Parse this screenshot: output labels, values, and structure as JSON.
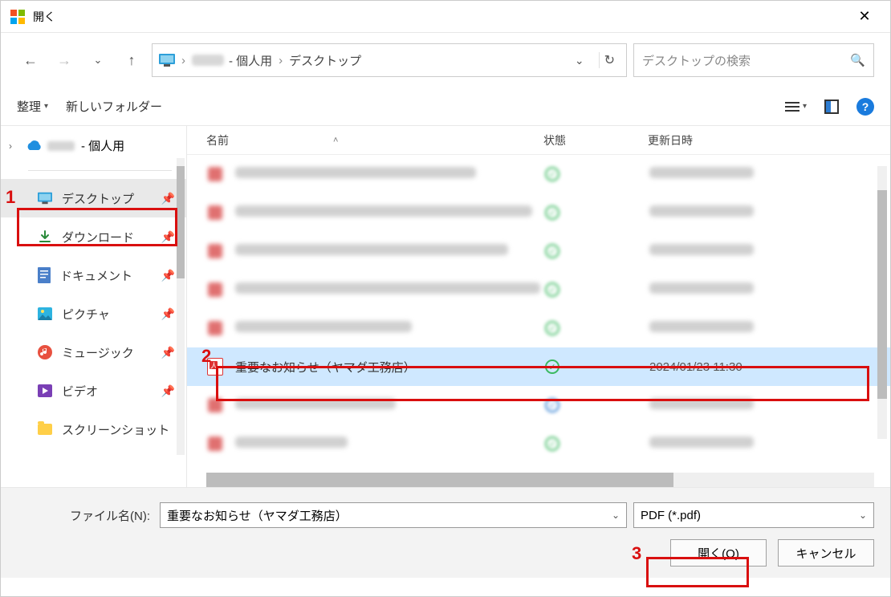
{
  "title": "開く",
  "breadcrumb": {
    "personal": "- 個人用",
    "desktop": "デスクトップ"
  },
  "search": {
    "placeholder": "デスクトップの検索"
  },
  "toolbar": {
    "organize": "整理",
    "newfolder": "新しいフォルダー"
  },
  "tree": {
    "root_personal": "- 個人用"
  },
  "sidebar": {
    "items": [
      {
        "label": "デスクトップ"
      },
      {
        "label": "ダウンロード"
      },
      {
        "label": "ドキュメント"
      },
      {
        "label": "ピクチャ"
      },
      {
        "label": "ミュージック"
      },
      {
        "label": "ビデオ"
      },
      {
        "label": "スクリーンショット"
      }
    ]
  },
  "columns": {
    "name": "名前",
    "state": "状態",
    "date": "更新日時"
  },
  "selected_file": {
    "name": "重要なお知らせ（ヤマダ工務店）",
    "date": "2024/01/23 11:30"
  },
  "footer": {
    "filename_label": "ファイル名(N):",
    "filename_value": "重要なお知らせ（ヤマダ工務店）",
    "filter": "PDF (*.pdf)",
    "open": "開く(O)",
    "cancel": "キャンセル"
  },
  "callouts": {
    "n1": "1",
    "n2": "2",
    "n3": "3"
  }
}
